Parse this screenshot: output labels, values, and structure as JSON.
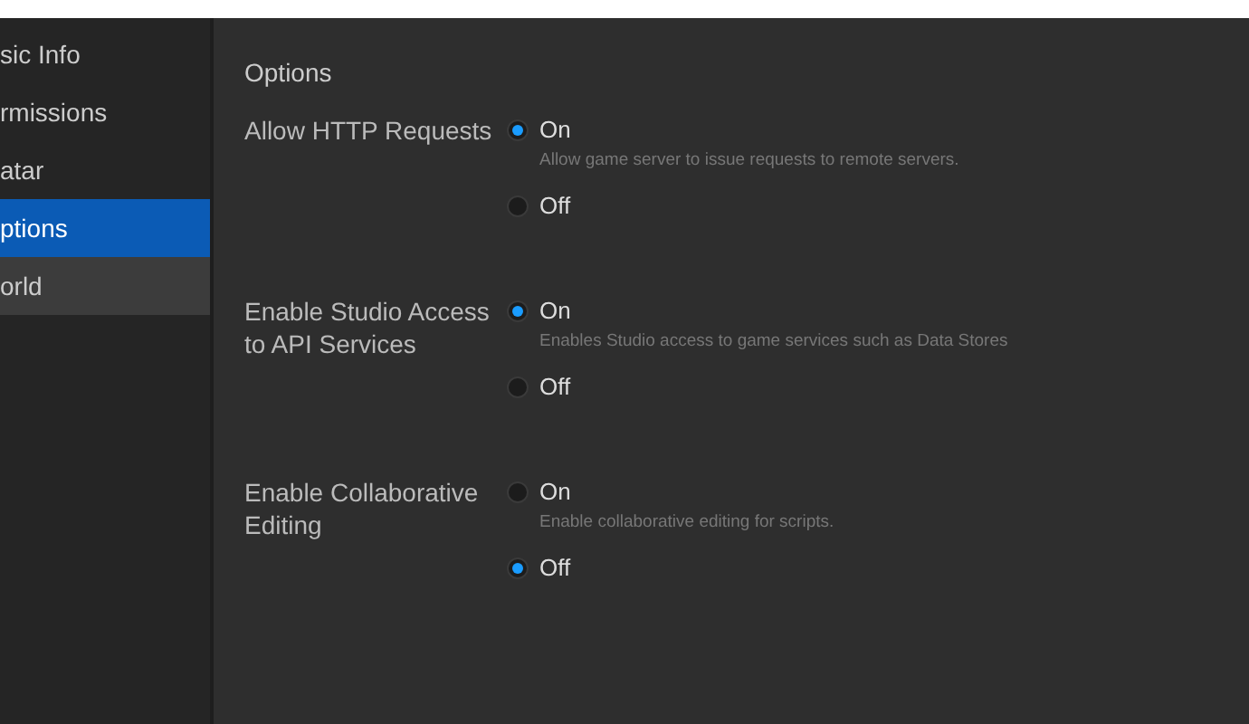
{
  "sidebar": {
    "items": [
      {
        "label": "sic Info",
        "selected": false,
        "hovered": false
      },
      {
        "label": "rmissions",
        "selected": false,
        "hovered": false
      },
      {
        "label": "atar",
        "selected": false,
        "hovered": false
      },
      {
        "label": "ptions",
        "selected": true,
        "hovered": false
      },
      {
        "label": "orld",
        "selected": false,
        "hovered": true
      }
    ]
  },
  "main": {
    "heading": "Options",
    "settings": [
      {
        "label": "Allow HTTP Requests",
        "options": [
          {
            "label": "On",
            "selected": true,
            "description": "Allow game server to issue requests to remote servers."
          },
          {
            "label": "Off",
            "selected": false
          }
        ]
      },
      {
        "label": "Enable Studio Access to API Services",
        "options": [
          {
            "label": "On",
            "selected": true,
            "description": "Enables Studio access to game services such as Data Stores"
          },
          {
            "label": "Off",
            "selected": false
          }
        ]
      },
      {
        "label": "Enable Collaborative Editing",
        "options": [
          {
            "label": "On",
            "selected": false,
            "description": "Enable collaborative editing for scripts."
          },
          {
            "label": "Off",
            "selected": true
          }
        ]
      }
    ]
  }
}
